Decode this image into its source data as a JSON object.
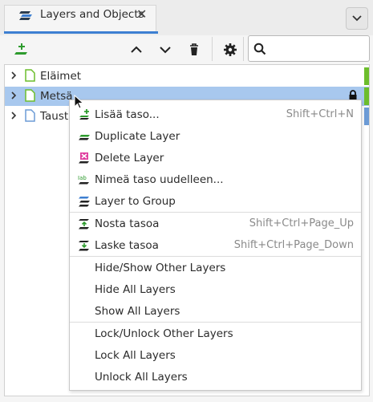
{
  "tab": {
    "title": "Layers and Objects",
    "close": "✕"
  },
  "toolbar": {
    "search_placeholder": ""
  },
  "layers": [
    {
      "name": "Eläimet",
      "color": "#6cbd2c",
      "selected": false
    },
    {
      "name": "Metsä",
      "color": "#6cbd2c",
      "selected": true,
      "locked": true
    },
    {
      "name": "Tausta",
      "color": "#6c9bd6",
      "selected": false
    }
  ],
  "menu": {
    "add_layer": {
      "label": "Lisää taso...",
      "shortcut": "Shift+Ctrl+N"
    },
    "duplicate": {
      "label": "Duplicate Layer"
    },
    "delete": {
      "label": "Delete Layer"
    },
    "rename": {
      "label": "Nimeä taso uudelleen..."
    },
    "to_group": {
      "label": "Layer to Group"
    },
    "raise": {
      "label": "Nosta tasoa",
      "shortcut": "Shift+Ctrl+Page_Up"
    },
    "lower": {
      "label": "Laske tasoa",
      "shortcut": "Shift+Ctrl+Page_Down"
    },
    "hide_show_other": {
      "label": "Hide/Show Other Layers"
    },
    "hide_all": {
      "label": "Hide All Layers"
    },
    "show_all": {
      "label": "Show All Layers"
    },
    "lock_unlock_other": {
      "label": "Lock/Unlock Other Layers"
    },
    "lock_all": {
      "label": "Lock All Layers"
    },
    "unlock_all": {
      "label": "Unlock All Layers"
    }
  },
  "colors": {
    "accent": "#3d7fd1",
    "selection": "#a8c8ee",
    "layer_green": "#6cbd2c",
    "layer_blue": "#6c9bd6"
  }
}
